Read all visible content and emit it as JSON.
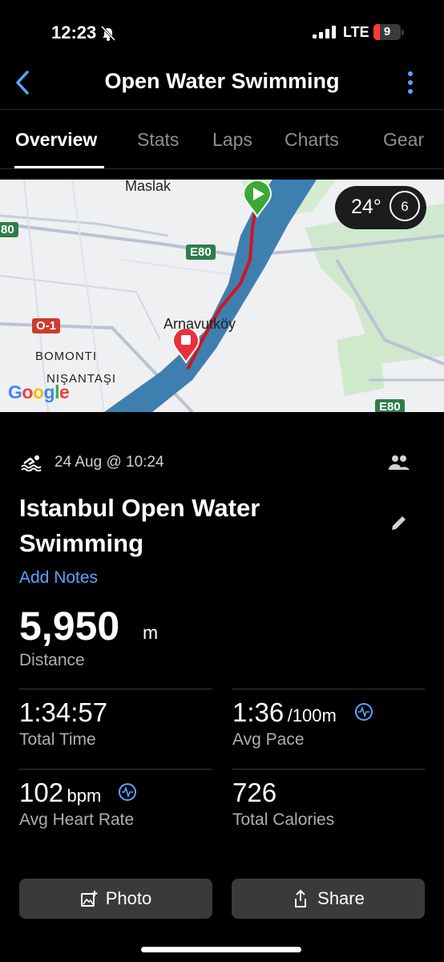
{
  "status_bar": {
    "time": "12:23",
    "network": "LTE",
    "battery": "9"
  },
  "header": {
    "title": "Open Water Swimming"
  },
  "tabs": [
    {
      "label": "Overview",
      "active": true
    },
    {
      "label": "Stats"
    },
    {
      "label": "Laps"
    },
    {
      "label": "Charts"
    },
    {
      "label": "Gear"
    }
  ],
  "map": {
    "weather": {
      "temperature": "24°",
      "wind": "6"
    },
    "labels": {
      "maslak": "Maslak",
      "arnavutkoy": "Arnavutköy",
      "bomonti": "BOMONTI",
      "nisantasi": "NIŞANTAŞI",
      "google": "Google"
    },
    "road_badges": {
      "e80_top": "E80",
      "e80_bottom": "E80",
      "o1": "O-1",
      "left_edge": "80"
    },
    "colors": {
      "water": "#3f7fb0",
      "route": "#d4141c",
      "land": "#eef0f1",
      "park": "#c8e6c4"
    }
  },
  "activity": {
    "date": "24 Aug @ 10:24",
    "title": "Istanbul Open Water Swimming",
    "add_notes": "Add Notes",
    "distance": {
      "value": "5,950",
      "unit": "m",
      "label": "Distance"
    },
    "stats": [
      {
        "value": "1:34:57",
        "unit": "",
        "label": "Total Time"
      },
      {
        "value": "1:36",
        "unit": "/100m",
        "label": "Avg Pace"
      },
      {
        "value": "102",
        "unit": "bpm",
        "label": "Avg Heart Rate"
      },
      {
        "value": "726",
        "unit": "",
        "label": "Total Calories"
      }
    ]
  },
  "buttons": {
    "photo": "Photo",
    "share": "Share"
  },
  "colors": {
    "accent": "#5aa4ff",
    "background": "#000000",
    "button": "#3a3a3c"
  }
}
